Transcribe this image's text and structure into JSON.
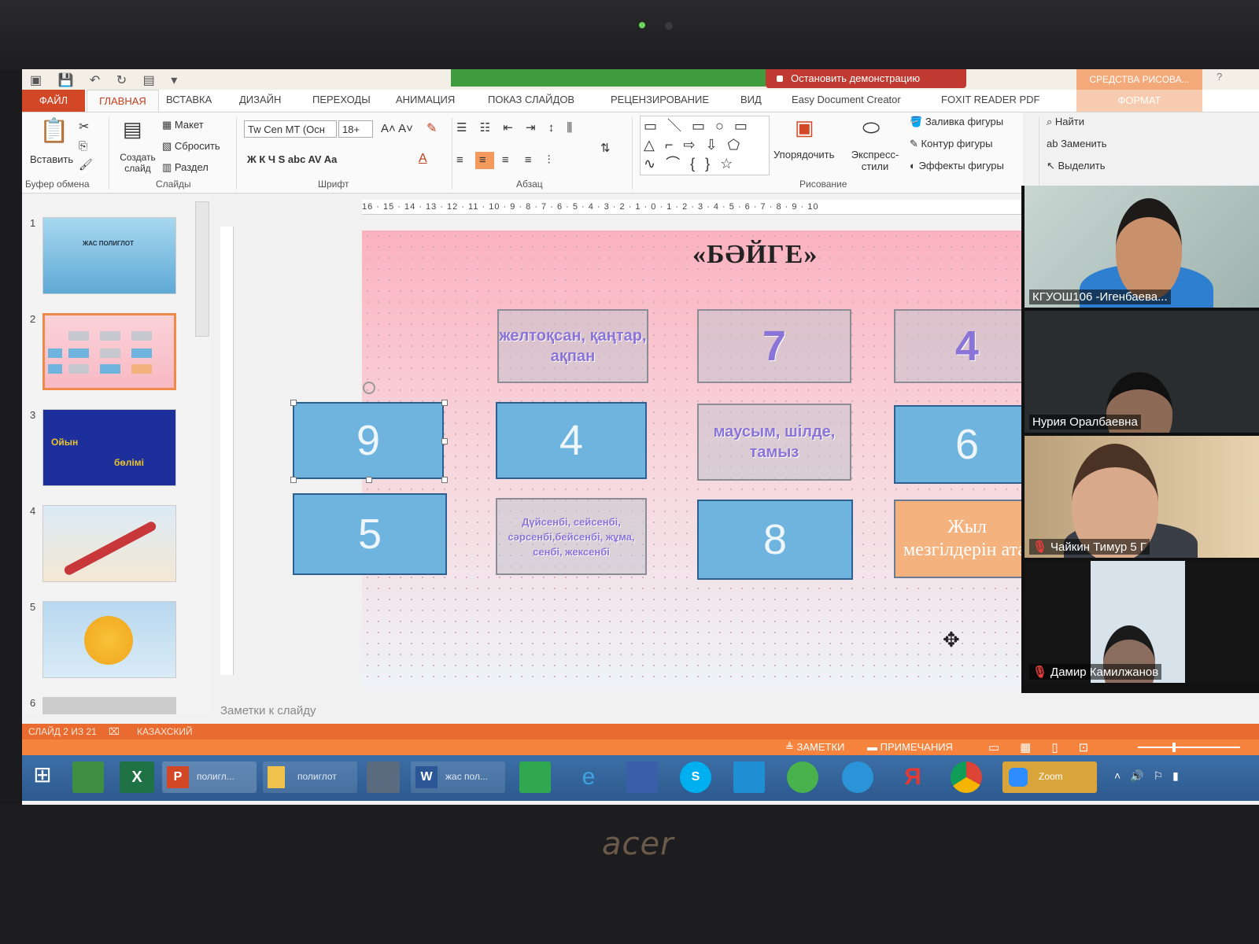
{
  "qat": {
    "icons": "▣ 💾 ↶ ↻ ▤ ▾"
  },
  "share": {
    "stop_label": "Остановить демонстрацию"
  },
  "context_tab": {
    "group_label": "СРЕДСТВА РИСОВА...",
    "format_label": "ФОРМАТ"
  },
  "tabs": [
    "ФАЙЛ",
    "ГЛАВНАЯ",
    "ВСТАВКА",
    "ДИЗАЙН",
    "ПЕРЕХОДЫ",
    "АНИМАЦИЯ",
    "ПОКАЗ СЛАЙДОВ",
    "РЕЦЕНЗИРОВАНИЕ",
    "ВИД",
    "Easy Document Creator",
    "FOXIT READER PDF"
  ],
  "ribbon": {
    "paste": "Вставить",
    "clipboard_group": "Буфер обмена",
    "new_slide": "Создать слайд",
    "layout": "Макет",
    "reset": "Сбросить",
    "section": "Раздел",
    "slides_group": "Слайды",
    "font_name": "Tw Cen MT (Осн",
    "font_size": "18+",
    "font_group": "Шрифт",
    "font_buttons": "Ж  К  Ч  S  abc  AV  Aa",
    "paragraph_group": "Абзац",
    "arrange": "Упорядочить",
    "quick_styles": "Экспресс-стили",
    "drawing_group": "Рисование",
    "shape_fill": "Заливка фигуры",
    "shape_outline": "Контур фигуры",
    "shape_effects": "Эффекты фигуры",
    "find": "Найти",
    "replace": "Заменить",
    "select": "Выделить"
  },
  "ruler": "16 · 15 · 14 · 13 · 12 · 11 · 10 · 9 · 8 · 7 · 6 · 5 · 4 · 3 · 2 · 1 · 0 · 1 · 2 · 3 · 4 · 5 · 6 · 7 · 8 · 9 · 10",
  "thumbnails": {
    "numbers": [
      "1",
      "2",
      "3",
      "4",
      "5",
      "6"
    ],
    "t1_title": "ЖАС ПОЛИГЛОТ",
    "t3_a": "Ойын",
    "t3_b": "бөлімі"
  },
  "slide": {
    "title": "«БӘЙГЕ»",
    "cards": {
      "c1": "желтоқсан, қаңтар, ақпан",
      "c2": "7",
      "c3": "4",
      "c4": "9",
      "c5": "4",
      "c6": "маусым, шілде, тамыз",
      "c7": "6",
      "c8": "5",
      "c9": "Дүйсенбі, сейсенбі, сәрсенбі,бейсенбі, жұма, сенбі, жексенбі",
      "c10": "8",
      "c11": "Жыл мезгілдерін ата."
    }
  },
  "notes_placeholder": "Заметки к слайду",
  "status": {
    "slide_count": "СЛАЙД 2 ИЗ 21",
    "language": "КАЗАХСКИЙ",
    "notes": "ЗАМЕТКИ",
    "comments": "ПРИМЕЧАНИЯ"
  },
  "taskbar": {
    "ppt_label": "полигл...",
    "folder_label": "полиглот",
    "word_label": "жас пол...",
    "zoom_label": "Zoom"
  },
  "zoom": {
    "p1": "КГУОШ106 -Игенбаева...",
    "p2": "Нурия Оралбаевна",
    "p3": "Чайкин Тимур 5 Г",
    "p4": "Дамир Камилжанов"
  },
  "brand": "acer",
  "colors": {
    "accent": "#d24726",
    "slide_blue": "#6fb4df",
    "slide_orange": "#f3b27e",
    "word_purple": "#8a74d8"
  }
}
